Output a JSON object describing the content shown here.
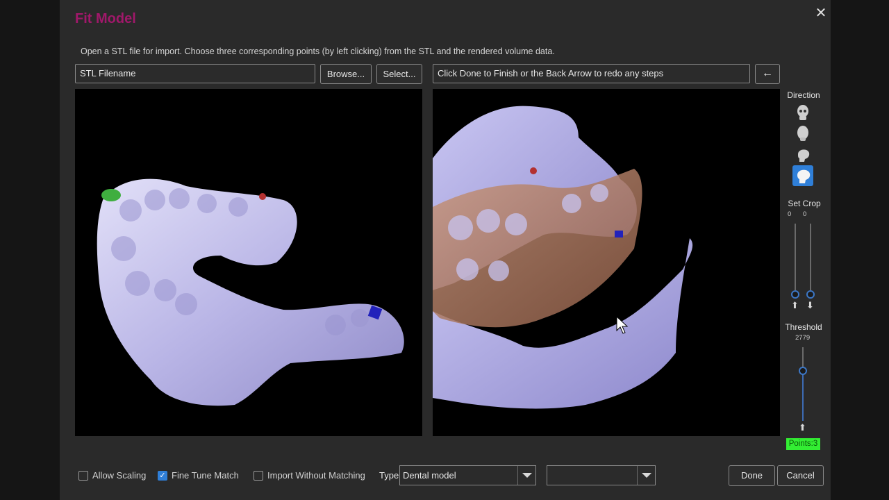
{
  "dialog": {
    "title": "Fit Model",
    "close_icon": "close-icon",
    "instructions": "Open a STL file for import.  Choose three corresponding points (by left clicking) from the STL and the rendered volume data."
  },
  "stl": {
    "filename_value": "STL Filename",
    "browse_label": "Browse...",
    "select_label": "Select..."
  },
  "status": {
    "message": "Click Done to Finish or the Back Arrow to redo any steps",
    "back_arrow": "←"
  },
  "sidebar": {
    "direction_label": "Direction",
    "direction_icons": [
      "skull-front-icon",
      "skull-back-icon",
      "skull-side-icon",
      "skull-side-selected-icon"
    ],
    "set_crop_label": "Set Crop",
    "crop_values": [
      "0",
      "0"
    ],
    "threshold_label": "Threshold",
    "threshold_value": "2779",
    "points_label": "Points:3"
  },
  "options": {
    "allow_scaling": {
      "label": "Allow Scaling",
      "checked": false
    },
    "fine_tune_match": {
      "label": "Fine Tune Match",
      "checked": true
    },
    "import_without_matching": {
      "label": "Import Without Matching",
      "checked": false
    },
    "type_label": "Type",
    "type_value": "Dental model",
    "second_select_value": ""
  },
  "actions": {
    "done_label": "Done",
    "cancel_label": "Cancel"
  },
  "colors": {
    "title": "#a0186a",
    "accent": "#2f7fd8",
    "points_badge": "#33ee33",
    "model_surface": "#b8b4e8"
  }
}
